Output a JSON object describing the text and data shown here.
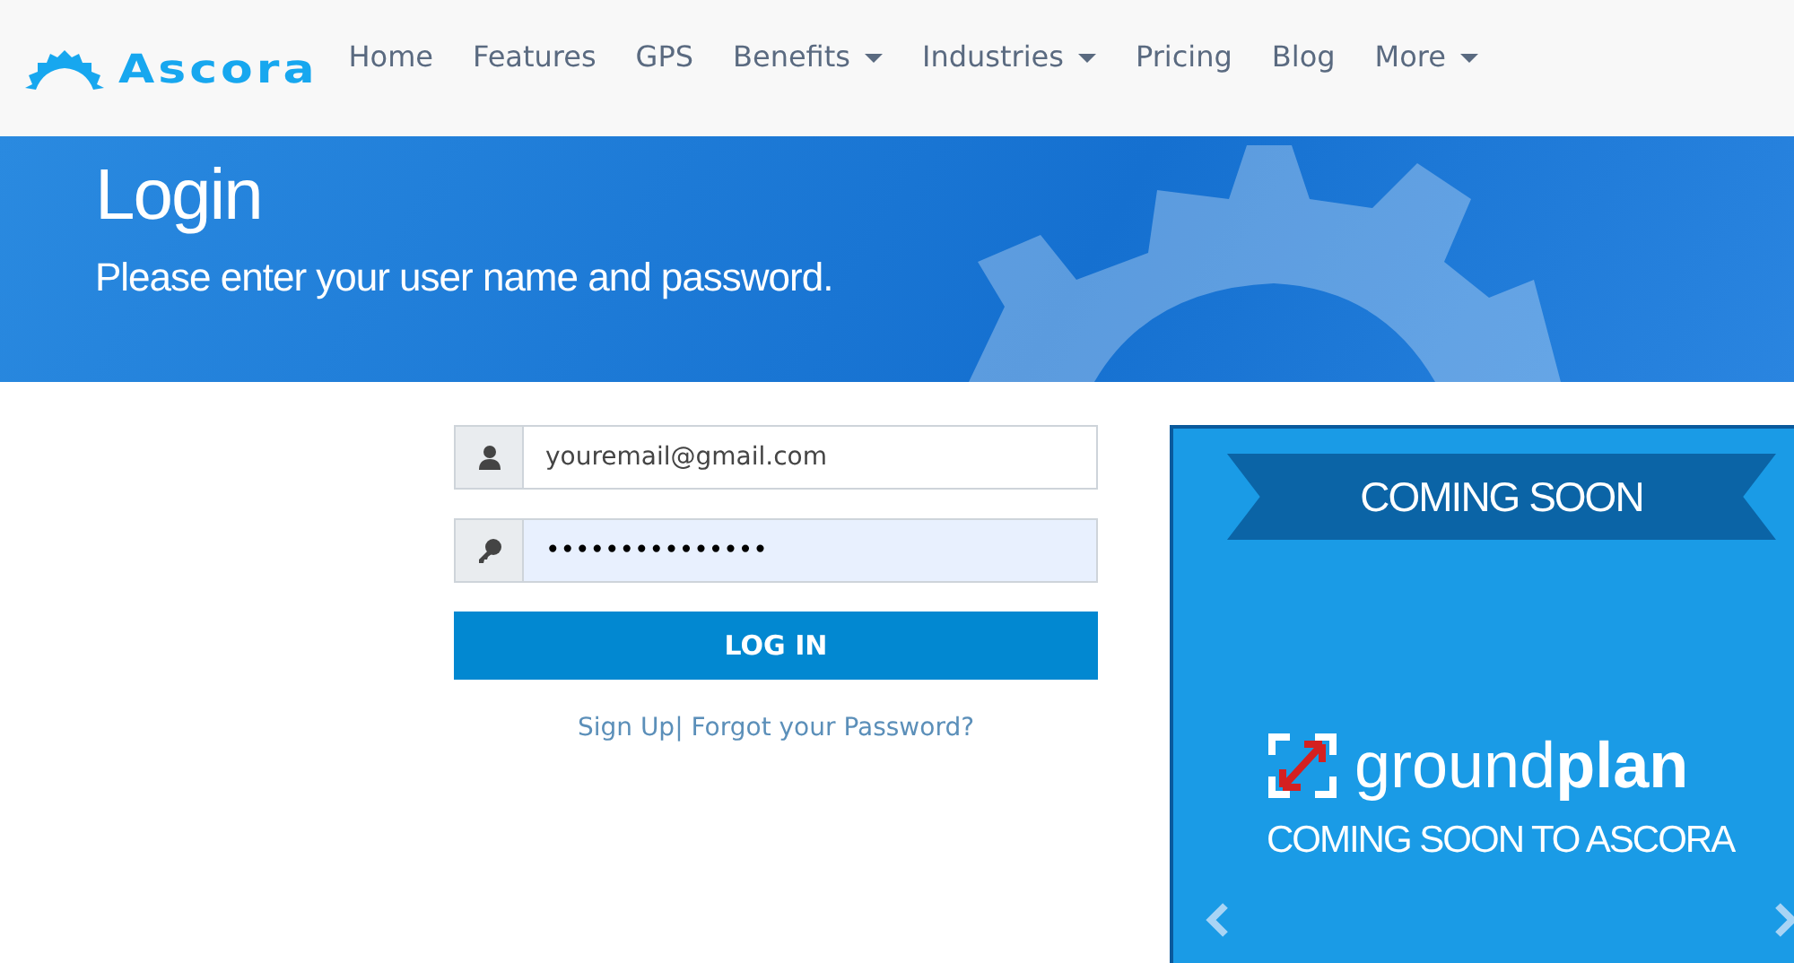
{
  "brand": {
    "name": "Ascora"
  },
  "nav": [
    {
      "label": "Home",
      "dropdown": false
    },
    {
      "label": "Features",
      "dropdown": false
    },
    {
      "label": "GPS",
      "dropdown": false
    },
    {
      "label": "Benefits",
      "dropdown": true
    },
    {
      "label": "Industries",
      "dropdown": true
    },
    {
      "label": "Pricing",
      "dropdown": false
    },
    {
      "label": "Blog",
      "dropdown": false
    },
    {
      "label": "More",
      "dropdown": true
    }
  ],
  "banner": {
    "title": "Login",
    "subtitle": "Please enter your user name and password."
  },
  "form": {
    "email": {
      "value": "youremail@gmail.com",
      "autofilled": false
    },
    "password": {
      "value": "•••••••••••••••",
      "autofilled": true
    },
    "submit": "LOG IN",
    "links": [
      "Sign Up",
      "Forgot your Password?"
    ],
    "separator": "|"
  },
  "promo": {
    "ribbon": "COMING SOON",
    "product": {
      "light": "ground",
      "bold": "plan"
    },
    "tagline": "COMING SOON TO ASCORA"
  }
}
